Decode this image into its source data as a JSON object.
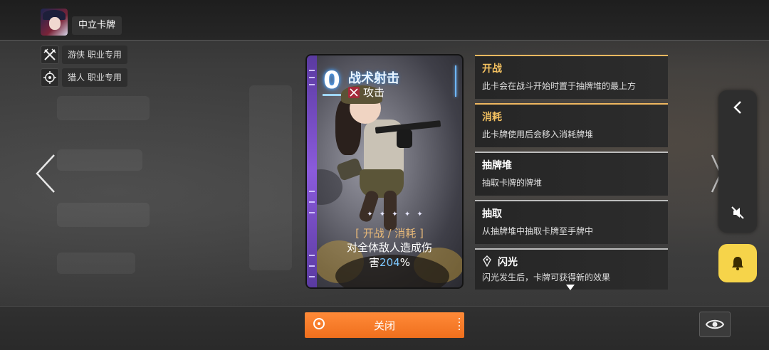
{
  "header": {
    "title": "中立卡牌"
  },
  "class_tags": [
    {
      "label": "游侠 职业专用",
      "icon": "crossed-swords-icon"
    },
    {
      "label": "猎人 职业专用",
      "icon": "target-icon"
    }
  ],
  "card": {
    "cost": "0",
    "name": "战术射击",
    "type": "攻击",
    "sparkles": "✦ ✦ ✦ ✦ ✦",
    "tags": "[ 开战 / 消耗 ]",
    "desc_line1": "对全体敌人造成伤",
    "desc_line2_prefix": "害",
    "desc_value": "204",
    "desc_suffix": "%",
    "accent_color": "#8b5bdc"
  },
  "keywords": [
    {
      "title": "开战",
      "desc": "此卡会在战斗开始时置于抽牌堆的最上方",
      "active": true
    },
    {
      "title": "消耗",
      "desc": "此卡牌使用后会移入消耗牌堆",
      "active": true
    },
    {
      "title": "抽牌堆",
      "desc": "抽取卡牌的牌堆",
      "active": false
    },
    {
      "title": "抽取",
      "desc": "从抽牌堆中抽取卡牌至手牌中",
      "active": false
    },
    {
      "title": "闪光",
      "desc": "闪光发生后，卡牌可获得新的效果",
      "active": false,
      "icon": "flash-icon"
    }
  ],
  "footer": {
    "close_label": "关闭"
  },
  "colors": {
    "close_button": "#f47a2a",
    "bell_button": "#f6d44a",
    "keyword_active": "#f2c060"
  }
}
